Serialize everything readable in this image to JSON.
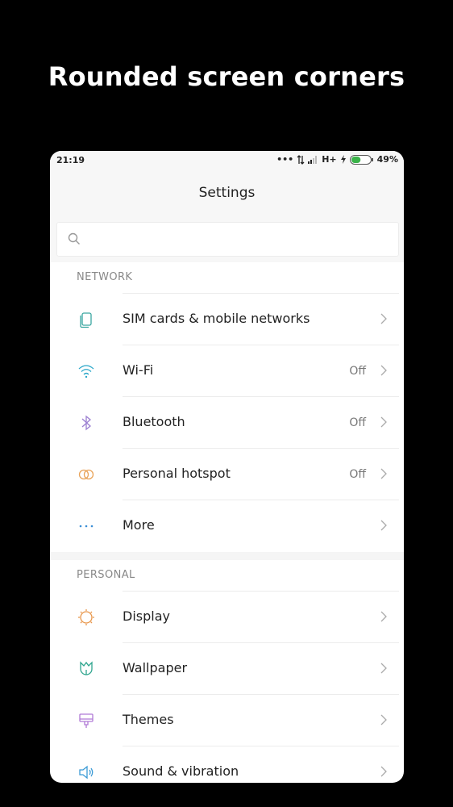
{
  "headline": "Rounded screen corners",
  "status": {
    "time": "21:19",
    "network_type": "H+",
    "battery_percent": "49%",
    "battery_level": 0.49
  },
  "header": {
    "title": "Settings"
  },
  "search": {
    "placeholder": ""
  },
  "sections": [
    {
      "title": "NETWORK",
      "items": [
        {
          "label": "SIM cards & mobile networks",
          "value": "",
          "icon": "sim-card-icon"
        },
        {
          "label": "Wi-Fi",
          "value": "Off",
          "icon": "wifi-icon"
        },
        {
          "label": "Bluetooth",
          "value": "Off",
          "icon": "bluetooth-icon"
        },
        {
          "label": "Personal hotspot",
          "value": "Off",
          "icon": "hotspot-icon"
        },
        {
          "label": "More",
          "value": "",
          "icon": "more-dots-icon"
        }
      ]
    },
    {
      "title": "PERSONAL",
      "items": [
        {
          "label": "Display",
          "value": "",
          "icon": "display-sun-icon"
        },
        {
          "label": "Wallpaper",
          "value": "",
          "icon": "wallpaper-tulip-icon"
        },
        {
          "label": "Themes",
          "value": "",
          "icon": "themes-brush-icon"
        },
        {
          "label": "Sound & vibration",
          "value": "",
          "icon": "speaker-icon"
        }
      ]
    }
  ],
  "colors": {
    "sim": "#3aa6a0",
    "wifi": "#2aa7c9",
    "bluetooth": "#9b7fd1",
    "hotspot": "#e9a45a",
    "more": "#3b8ed6",
    "display": "#e8964a",
    "wallpaper": "#2fa58e",
    "themes": "#b07ad6",
    "sound": "#3b9bd6"
  }
}
